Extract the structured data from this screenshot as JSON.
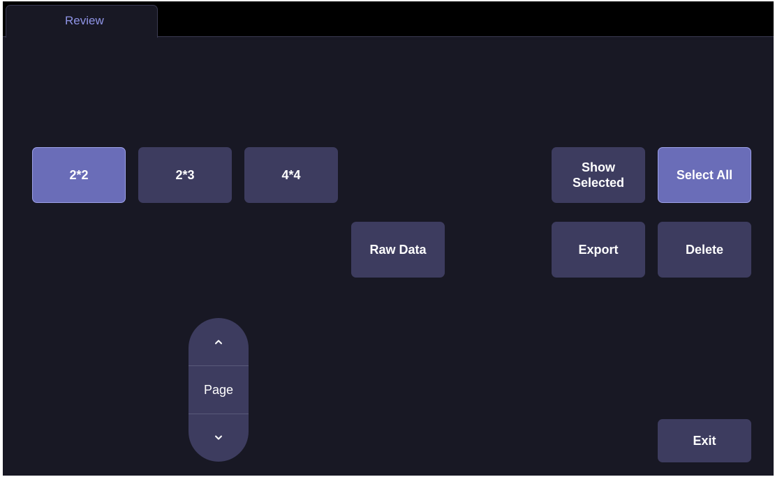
{
  "tabs": [
    {
      "label": "Review",
      "active": true
    }
  ],
  "layout_buttons": [
    {
      "label": "2*2",
      "selected": true
    },
    {
      "label": "2*3",
      "selected": false
    },
    {
      "label": "4*4",
      "selected": false
    }
  ],
  "actions": {
    "show_selected": "Show\nSelected",
    "select_all": "Select All",
    "raw_data": "Raw Data",
    "export": "Export",
    "delete": "Delete",
    "exit": "Exit"
  },
  "pager": {
    "label": "Page",
    "up_icon": "chevron-up-icon",
    "down_icon": "chevron-down-icon"
  },
  "colors": {
    "background": "#181824",
    "button": "#3d3c5f",
    "button_active": "#6a6db8",
    "tab_text": "#8f94e6"
  }
}
